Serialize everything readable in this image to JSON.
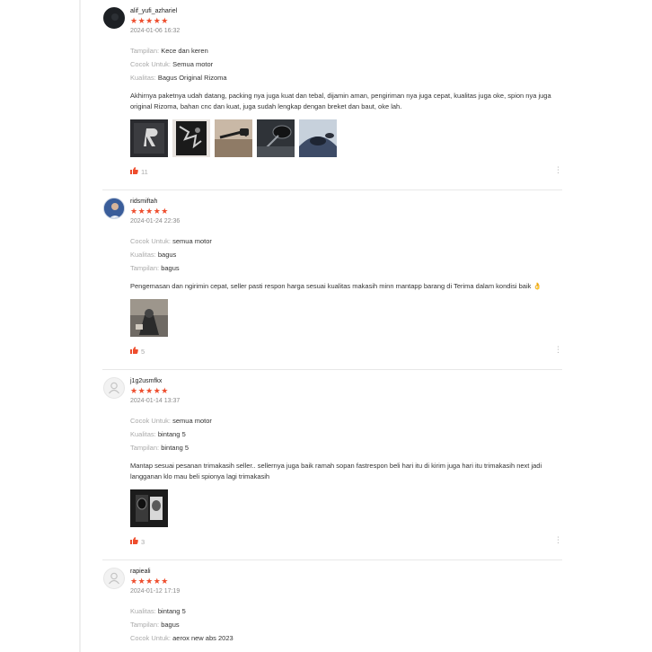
{
  "colors": {
    "star": "#ee4d2d",
    "like": "#ee4d2d",
    "label": "#a9a9a9"
  },
  "reviews": [
    {
      "username": "alif_yufi_azhariel",
      "stars": "★★★★★",
      "date": "2024-01-06 16:32",
      "attributes": [
        {
          "key": "Tampilan:",
          "value": "Kece dan keren"
        },
        {
          "key": "Cocok Untuk:",
          "value": "Semua motor"
        },
        {
          "key": "Kualitas:",
          "value": "Bagus Original Rizoma"
        }
      ],
      "comment": "Akhirnya paketnya udah datang, packing nya juga kuat dan tebal, dijamin aman, pengiriman nya juga cepat, kualitas juga oke, spion nya juga original Rizoma, bahan cnc dan kuat, juga sudah lengkap dengan breket dan baut, oke lah.",
      "photo_count": 5,
      "likes": "11"
    },
    {
      "username": "ridsmiftah",
      "stars": "★★★★★",
      "date": "2024-01-24 22:36",
      "attributes": [
        {
          "key": "Cocok Untuk:",
          "value": "semua motor"
        },
        {
          "key": "Kualitas:",
          "value": "bagus"
        },
        {
          "key": "Tampilan:",
          "value": "bagus"
        }
      ],
      "comment": "Pengemasan dan ngirimin cepat, seller pasti respon harga sesuai kualitas makasih minn mantapp barang di Terima dalam kondisi baik 👌",
      "photo_count": 1,
      "likes": "5"
    },
    {
      "username": "j1g2usmfkx",
      "stars": "★★★★★",
      "date": "2024-01-14 13:37",
      "attributes": [
        {
          "key": "Cocok Untuk:",
          "value": "semua motor"
        },
        {
          "key": "Kualitas:",
          "value": "bintang 5"
        },
        {
          "key": "Tampilan:",
          "value": "bintang 5"
        }
      ],
      "comment": "Mantap sesuai pesanan trimakasih seller.. sellernya juga baik ramah sopan fastrespon beli hari itu di kirim juga hari itu trimakasih next jadi langganan klo mau beli spionya lagi trimakasih",
      "photo_count": 1,
      "likes": "3"
    },
    {
      "username": "rapieali",
      "stars": "★★★★★",
      "date": "2024-01-12 17:19",
      "attributes": [
        {
          "key": "Kualitas:",
          "value": "bintang 5"
        },
        {
          "key": "Tampilan:",
          "value": "bagus"
        },
        {
          "key": "Cocok Untuk:",
          "value": "aerox new abs 2023"
        }
      ]
    }
  ]
}
